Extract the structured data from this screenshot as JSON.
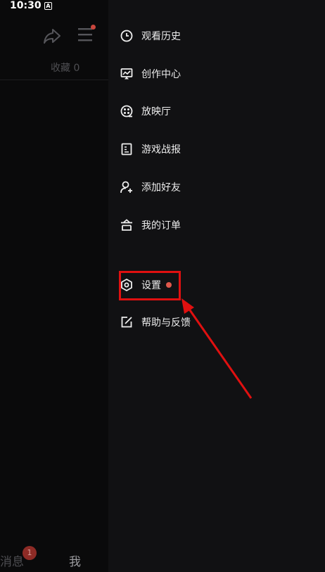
{
  "status_bar": {
    "time": "10:30",
    "notification_letter": "A"
  },
  "background_page": {
    "collect_label": "收藏 0",
    "bottom_tabs": {
      "messages_label": "消息",
      "messages_badge": "1",
      "me_label": "我"
    }
  },
  "drawer": {
    "items": [
      {
        "label": "观看历史",
        "icon": "clock-icon"
      },
      {
        "label": "创作中心",
        "icon": "monitor-chart-icon"
      },
      {
        "label": "放映厅",
        "icon": "film-reel-icon"
      },
      {
        "label": "游戏战报",
        "icon": "document-icon"
      },
      {
        "label": "添加好友",
        "icon": "add-person-icon"
      },
      {
        "label": "我的订单",
        "icon": "basket-icon"
      },
      {
        "label": "设置",
        "icon": "hexagon-gear-icon",
        "has_dot": true
      },
      {
        "label": "帮助与反馈",
        "icon": "edit-feedback-icon"
      }
    ]
  },
  "colors": {
    "highlight": "#e01010",
    "dot": "#e0584b",
    "drawer_bg": "#111113"
  }
}
